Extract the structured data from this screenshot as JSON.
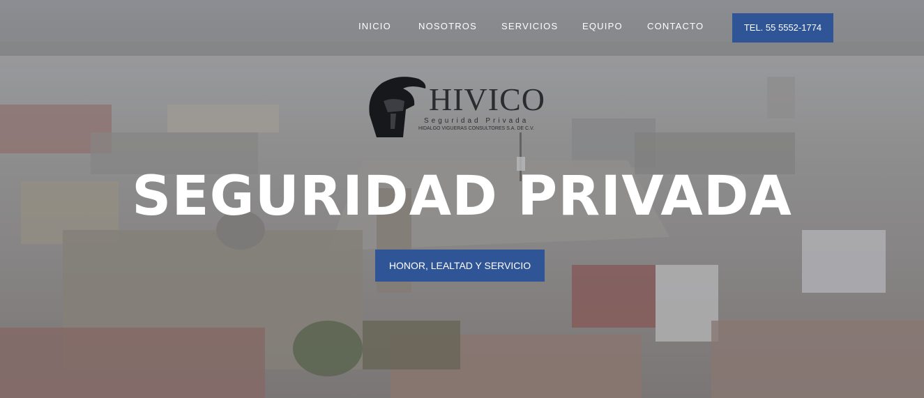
{
  "nav": {
    "items": [
      {
        "label": "INICIO"
      },
      {
        "label": "NOSOTROS"
      },
      {
        "label": "SERVICIOS"
      },
      {
        "label": "EQUIPO"
      },
      {
        "label": "CONTACTO"
      }
    ],
    "tel_label": "TEL. 55 5552-1774"
  },
  "logo": {
    "name": "HIVICO",
    "subtitle": "Seguridad Privada",
    "company": "HIDALGO VIGUERAS CONSULTORES S.A. DE C.V.",
    "icon": "spartan-helmet-icon"
  },
  "hero": {
    "title": "SEGURIDAD PRIVADA",
    "tagline": "HONOR, LEALTAD Y SERVICIO"
  },
  "colors": {
    "accent": "#2f5597",
    "text": "#ffffff",
    "logo": "#2b2c30"
  }
}
